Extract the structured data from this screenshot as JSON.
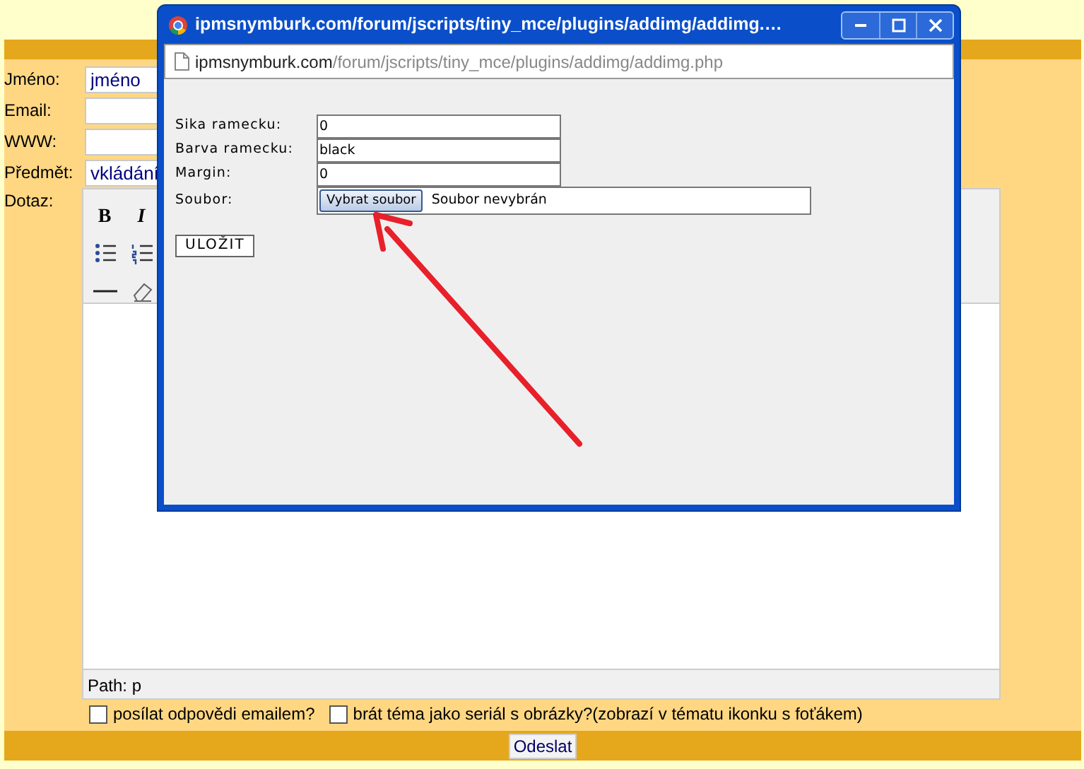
{
  "form": {
    "fields": [
      {
        "label": "Jméno:",
        "value": "jméno"
      },
      {
        "label": "Email:"
      },
      {
        "label": "WWW:"
      },
      {
        "label": "Předmět:",
        "value": "vkládání"
      }
    ],
    "message_label": "Dotaz:",
    "editor": {
      "toolbar_rows": [
        [
          {
            "kind": "bold",
            "text": "B"
          },
          {
            "kind": "italic",
            "text": "I"
          }
        ],
        [
          {
            "kind": "bullet-list"
          },
          {
            "kind": "numbered-list"
          }
        ],
        [
          {
            "kind": "horizontal-rule"
          },
          {
            "kind": "eraser"
          }
        ]
      ],
      "path": "Path: p"
    },
    "checkboxes": [
      {
        "label": "posílat odpovědi emailem?",
        "checked": false
      },
      {
        "label": "brát téma jako seriál s obrázky?(zobrazí v tématu ikonku s foťákem)",
        "checked": false
      }
    ],
    "submit": "Odeslat"
  },
  "popup": {
    "title": "ipmsnymburk.com/forum/jscripts/tiny_mce/plugins/addimg/addimg.…",
    "url_host": "ipmsnymburk.com",
    "url_path": "/forum/jscripts/tiny_mce/plugins/addimg/addimg.php",
    "fields": [
      {
        "label": "Sika ramecku:",
        "value": "0"
      },
      {
        "label": "Barva ramecku:",
        "value": "black"
      },
      {
        "label": "Margin:",
        "value": "0"
      }
    ],
    "file": {
      "label": "Soubor:",
      "button": "Vybrat soubor",
      "status": "Soubor nevybrán"
    },
    "save": "ULOŽIT"
  }
}
